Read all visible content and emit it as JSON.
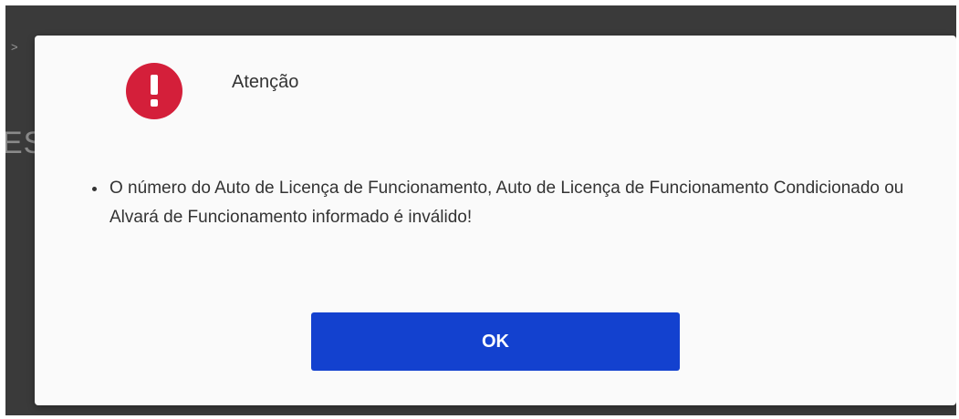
{
  "background": {
    "chevron": ">",
    "heading_fragment": "ES"
  },
  "dialog": {
    "icon": "exclamation-circle-icon",
    "icon_color": "#d41f3a",
    "title": "Atenção",
    "messages": [
      "O número do Auto de Licença de Funcionamento, Auto de Licença de Funcionamento Condicionado ou Alvará de Funcionamento informado é inválido!"
    ],
    "ok_label": "OK",
    "ok_color": "#1341cf"
  }
}
